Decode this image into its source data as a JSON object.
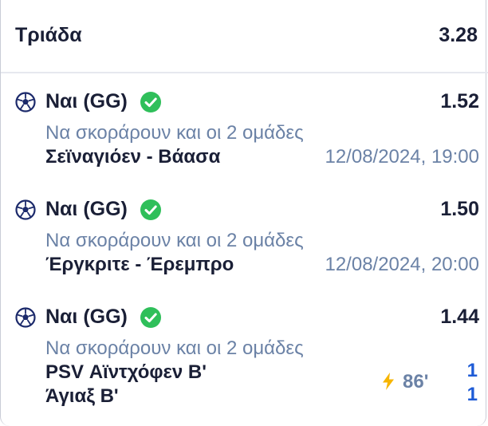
{
  "colors": {
    "text_dark": "#1a1f36",
    "text_muted": "#6b82a6",
    "check_green": "#2fbf5a",
    "score_blue": "#1e5bd6",
    "bolt_yellow": "#f7b500",
    "ball_navy": "#1c2a6b"
  },
  "header": {
    "title": "Τριάδα",
    "total_odds": "3.28"
  },
  "selections": [
    {
      "icon": "soccer-ball-icon",
      "status_icon": "check-circle-icon",
      "pick": "Ναι (GG)",
      "odds": "1.52",
      "market": "Να σκοράρουν και οι 2 ομάδες",
      "match": "Σεϊναγιόεν - Βάασα",
      "datetime": "12/08/2024, 19:00"
    },
    {
      "icon": "soccer-ball-icon",
      "status_icon": "check-circle-icon",
      "pick": "Ναι (GG)",
      "odds": "1.50",
      "market": "Να σκοράρουν και οι 2 ομάδες",
      "match": "Έργκριτε - Έρεμπρο",
      "datetime": "12/08/2024, 20:00"
    },
    {
      "icon": "soccer-ball-icon",
      "status_icon": "check-circle-icon",
      "pick": "Ναι (GG)",
      "odds": "1.44",
      "market": "Να σκοράρουν και οι 2 ομάδες",
      "home_team": "PSV Αϊντχόφεν Β'",
      "away_team": "Άγιαξ Β'",
      "live_icon": "lightning-icon",
      "minute": "86'",
      "home_score": "1",
      "away_score": "1"
    }
  ]
}
